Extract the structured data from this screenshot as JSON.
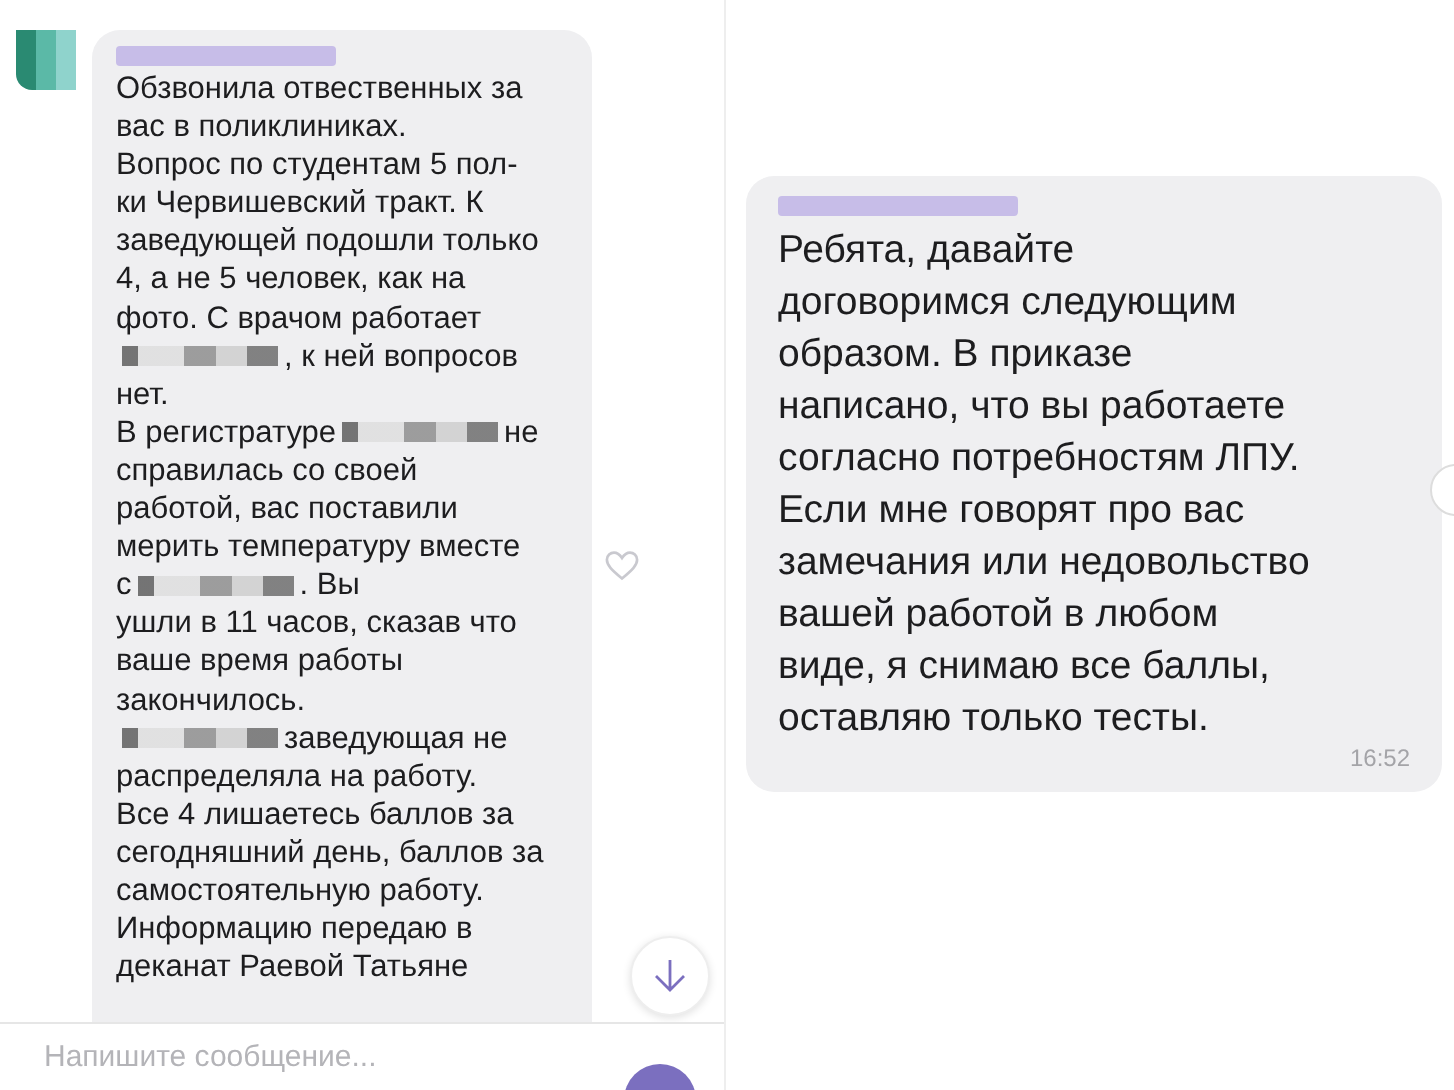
{
  "left_chat": {
    "message": {
      "lines": [
        {
          "parts": [
            {
              "kind": "text",
              "text": "Обзвонила отвественных за"
            }
          ]
        },
        {
          "parts": [
            {
              "kind": "text",
              "text": "вас в поликлиниках."
            }
          ]
        },
        {
          "parts": [
            {
              "kind": "text",
              "text": "Вопрос по студентам 5 пол-"
            }
          ]
        },
        {
          "parts": [
            {
              "kind": "text",
              "text": "ки Червишевский тракт. К"
            }
          ]
        },
        {
          "parts": [
            {
              "kind": "text",
              "text": "заведующей подошли только"
            }
          ]
        },
        {
          "parts": [
            {
              "kind": "text",
              "text": "4, а не 5 человек, как на"
            }
          ]
        },
        {
          "parts": [
            {
              "kind": "text",
              "text": "фото. С врачом работает"
            }
          ]
        },
        {
          "parts": [
            {
              "kind": "redacted"
            },
            {
              "kind": "text",
              "text": ", к ней вопросов"
            }
          ]
        },
        {
          "parts": [
            {
              "kind": "text",
              "text": "нет."
            }
          ]
        },
        {
          "parts": [
            {
              "kind": "text",
              "text": "В регистратуре"
            },
            {
              "kind": "redacted"
            },
            {
              "kind": "text",
              "text": "не"
            }
          ]
        },
        {
          "parts": [
            {
              "kind": "text",
              "text": "справилась со своей"
            }
          ]
        },
        {
          "parts": [
            {
              "kind": "text",
              "text": "работой, вас поставили"
            }
          ]
        },
        {
          "parts": [
            {
              "kind": "text",
              "text": "мерить температуру вместе"
            }
          ]
        },
        {
          "parts": [
            {
              "kind": "text",
              "text": "с"
            },
            {
              "kind": "redacted"
            },
            {
              "kind": "text",
              "text": ". Вы"
            }
          ]
        },
        {
          "parts": [
            {
              "kind": "text",
              "text": "ушли в 11 часов, сказав что"
            }
          ]
        },
        {
          "parts": [
            {
              "kind": "text",
              "text": "ваше время работы"
            }
          ]
        },
        {
          "parts": [
            {
              "kind": "text",
              "text": "закончилось."
            }
          ]
        },
        {
          "parts": [
            {
              "kind": "redacted"
            },
            {
              "kind": "text",
              "text": "заведующая не"
            }
          ]
        },
        {
          "parts": [
            {
              "kind": "text",
              "text": "распределяла на работу."
            }
          ]
        },
        {
          "parts": [
            {
              "kind": "text",
              "text": "Все 4 лишаетесь баллов за"
            }
          ]
        },
        {
          "parts": [
            {
              "kind": "text",
              "text": "сегодняшний день, баллов за"
            }
          ]
        },
        {
          "parts": [
            {
              "kind": "text",
              "text": "самостоятельную работу."
            }
          ]
        },
        {
          "parts": [
            {
              "kind": "text",
              "text": "Информацию передаю в"
            }
          ]
        },
        {
          "parts": [
            {
              "kind": "text",
              "text": "деканат Раевой Татьяне"
            }
          ]
        }
      ]
    },
    "input": {
      "placeholder": "Напишите сообщение..."
    }
  },
  "right_chat": {
    "message": {
      "lines": [
        "Ребята, давайте",
        "договоримся следующим",
        "образом. В приказе",
        "написано, что вы работаете",
        "согласно потребностям ЛПУ.",
        "Если мне говорят про вас",
        "замечания или недовольство",
        "вашей работой в любом",
        "виде, я снимаю все баллы,",
        "оставляю только тесты."
      ],
      "time": "16:52"
    }
  }
}
